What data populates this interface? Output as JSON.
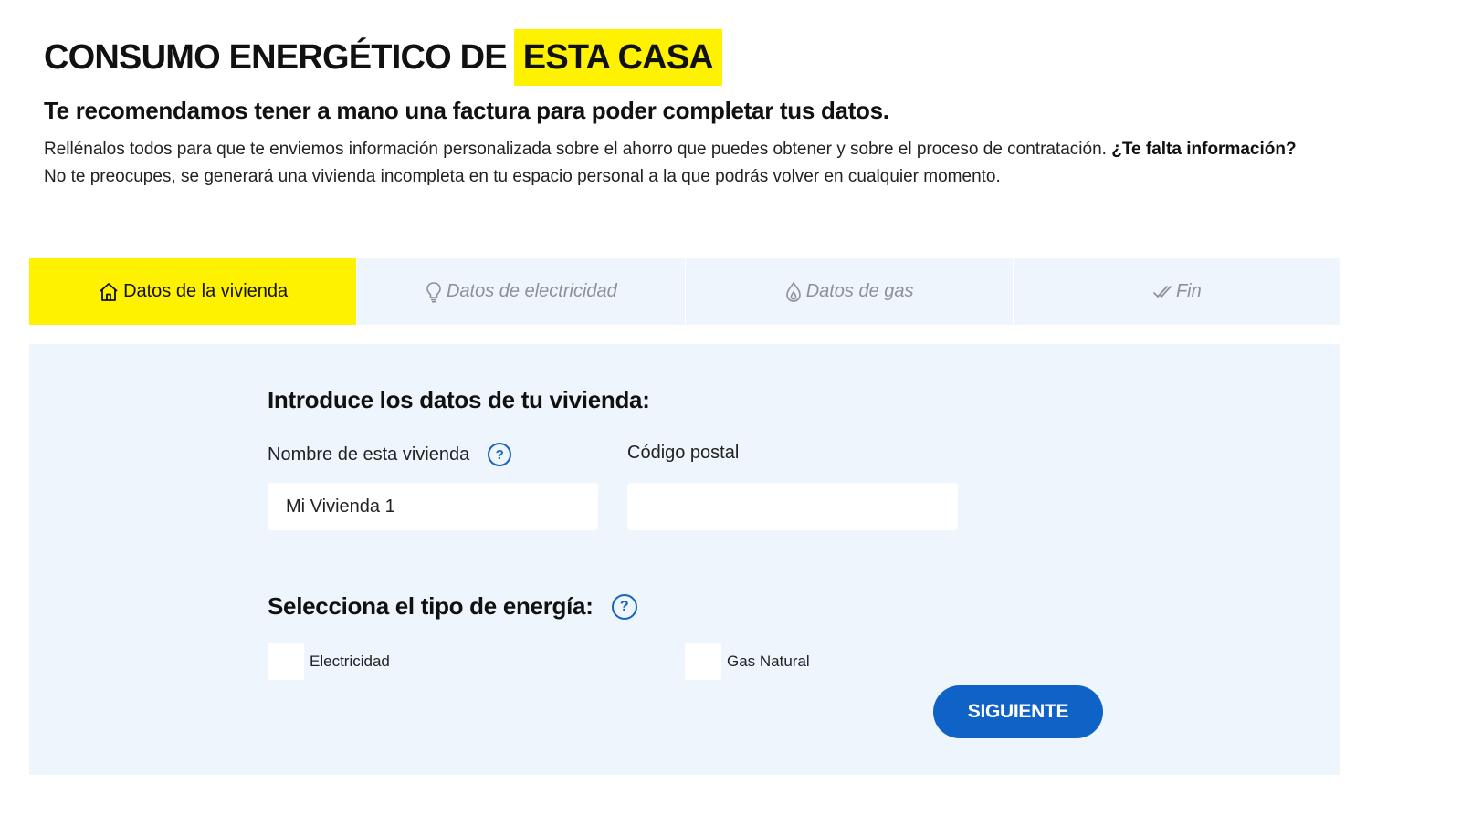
{
  "header": {
    "title": "CONSUMO ENERGÉTICO DE",
    "title_highlight": "ESTA CASA",
    "subtitle": "Te recomendamos tener a mano una factura para poder completar tus datos.",
    "intro_text": "Rellénalos todos para que te enviemos información personalizada sobre el ahorro que puedes obtener y sobre el proceso de contratación.",
    "intro_bold": "¿Te falta información?",
    "intro_text_2": "No te preocupes, se generará una vivienda incompleta en tu espacio personal a la que podrás volver en cualquier momento."
  },
  "tabs": [
    {
      "label": "Datos de la vivienda",
      "icon": "home-icon",
      "active": true
    },
    {
      "label": "Datos de electricidad",
      "icon": "lightbulb-icon",
      "active": false
    },
    {
      "label": "Datos de gas",
      "icon": "flame-drop-icon",
      "active": false
    },
    {
      "label": "Fin",
      "icon": "double-check-icon",
      "active": false
    }
  ],
  "form": {
    "title": "Introduce los datos de tu vivienda:",
    "name_label": "Nombre de esta vivienda",
    "name_value": "Mi Vivienda 1",
    "postal_label": "Código postal",
    "postal_value": "",
    "help_glyph": "?",
    "energy_title": "Selecciona el tipo de energía:",
    "energy_options": [
      {
        "label": "Electricidad",
        "checked": false
      },
      {
        "label": "Gas Natural",
        "checked": false
      }
    ],
    "next_label": "SIGUIENTE"
  },
  "colors": {
    "highlight": "#fff200",
    "panel_bg": "#eef5fd",
    "primary_blue": "#0f62c6",
    "help_blue": "#1565c0"
  }
}
